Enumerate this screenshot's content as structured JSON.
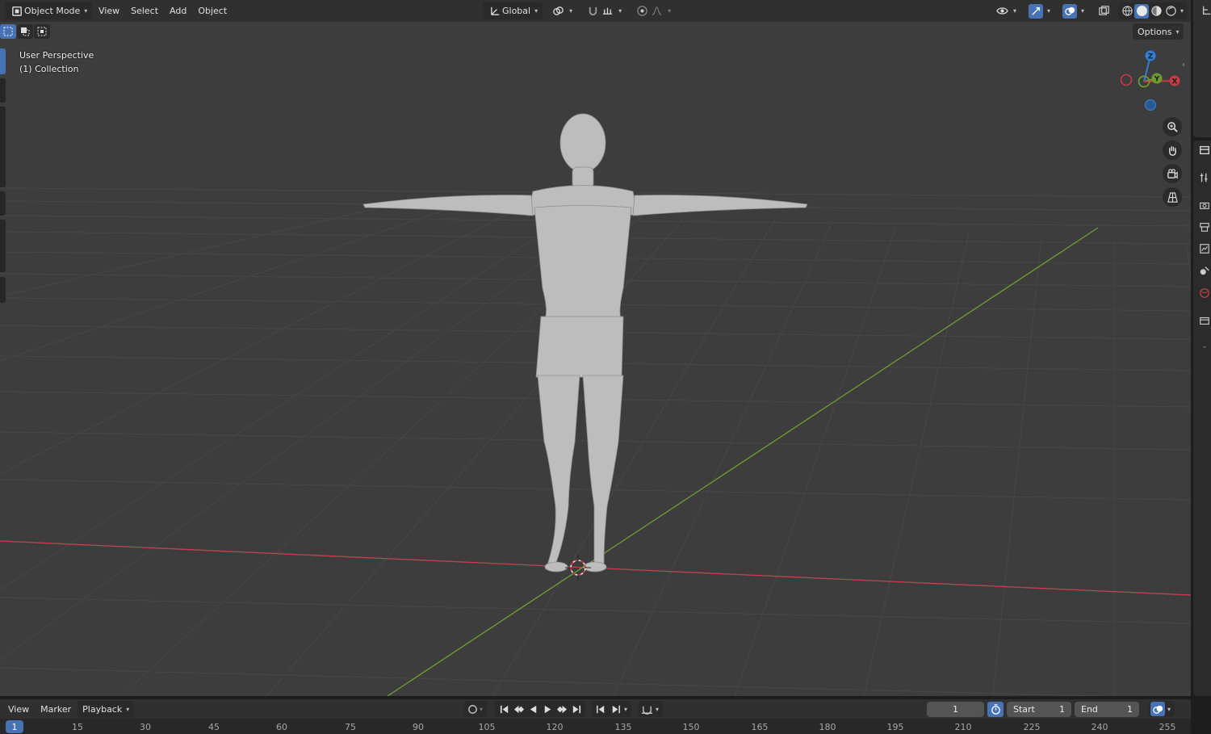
{
  "header": {
    "mode_label": "Object Mode",
    "menus": [
      "View",
      "Select",
      "Add",
      "Object"
    ],
    "transform_orientation": "Global",
    "options_label": "Options"
  },
  "viewport": {
    "perspective_label": "User Perspective",
    "collection_label": "(1) Collection",
    "gizmo_axes": {
      "z": "Z",
      "y": "Y",
      "x": "X"
    }
  },
  "timeline": {
    "menus": [
      "View",
      "Marker",
      "Playback"
    ],
    "current_frame": "1",
    "start_label": "Start",
    "start_value": "1",
    "end_label": "End",
    "end_value": "1",
    "ruler_current": "1",
    "ruler_ticks": [
      "15",
      "30",
      "45",
      "60",
      "75",
      "90",
      "105",
      "120",
      "135",
      "150",
      "165",
      "180",
      "195",
      "210",
      "225",
      "240",
      "255"
    ]
  },
  "colors": {
    "accent": "#4772b3",
    "axis_x": "#c83a46",
    "axis_y": "#6a9d2e",
    "axis_z": "#2f7fd8",
    "viewport_bg": "#3d3d3d"
  }
}
